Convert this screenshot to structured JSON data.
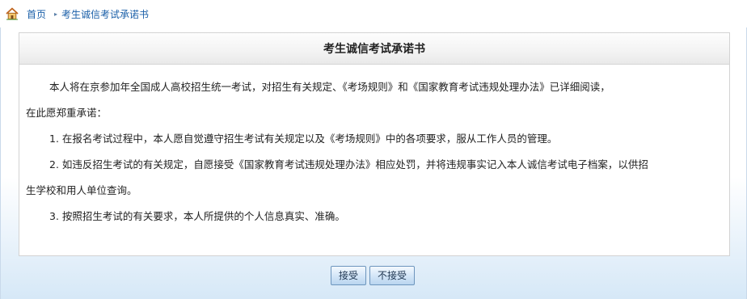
{
  "breadcrumb": {
    "home_label": "首页",
    "separator": "▸",
    "current": "考生诚信考试承诺书"
  },
  "panel": {
    "title": "考生诚信考试承诺书",
    "paragraphs": [
      "本人将在京参加年全国成人高校招生统一考试，对招生有关规定、《考场规则》和《国家教育考试违规处理办法》已详细阅读，",
      "在此愿郑重承诺：",
      "1. 在报名考试过程中，本人愿自觉遵守招生考试有关规定以及《考场规则》中的各项要求，服从工作人员的管理。",
      "2. 如违反招生考试的有关规定，自愿接受《国家教育考试违规处理办法》相应处罚，并将违规事实记入本人诚信考试电子档案，以供招",
      "生学校和用人单位查询。",
      "3. 按照招生考试的有关要求，本人所提供的个人信息真实、准确。"
    ]
  },
  "buttons": {
    "accept_label": "接受",
    "reject_label": "不接受"
  },
  "colors": {
    "link": "#1a5fa8",
    "button_border": "#6d95bd",
    "panel_border": "#d3d3d3"
  },
  "icons": {
    "home": "home-icon"
  }
}
